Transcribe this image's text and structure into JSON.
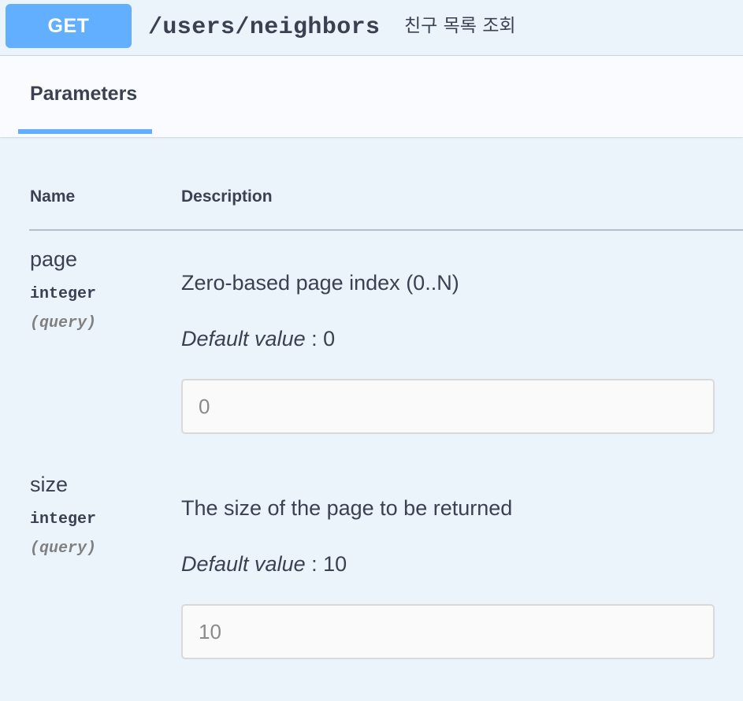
{
  "operation": {
    "method": "GET",
    "path": "/users/neighbors",
    "summary": "친구 목록 조회",
    "method_color": "#61affe"
  },
  "tabs": [
    {
      "label": "Parameters",
      "active": true
    }
  ],
  "table": {
    "name_header": "Name",
    "description_header": "Description"
  },
  "parameters": [
    {
      "name": "page",
      "type": "integer",
      "in": "(query)",
      "description": "Zero-based page index (0..N)",
      "default_label": "Default value",
      "default_sep": " : ",
      "default_value": "0",
      "input_placeholder": "0"
    },
    {
      "name": "size",
      "type": "integer",
      "in": "(query)",
      "description": "The size of the page to be returned",
      "default_label": "Default value",
      "default_sep": " : ",
      "default_value": "10",
      "input_placeholder": "10"
    }
  ]
}
